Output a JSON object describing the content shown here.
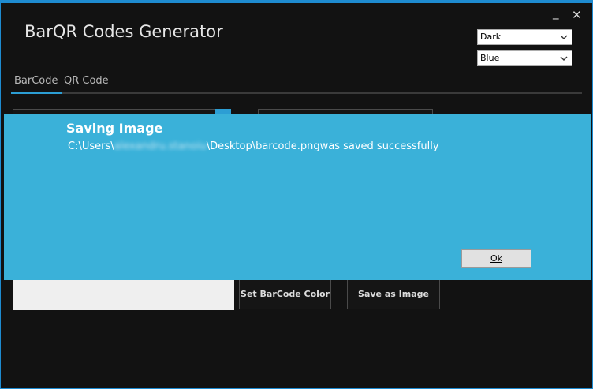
{
  "app": {
    "title": "BarQR Codes Generator"
  },
  "window_controls": {
    "minimize": "_",
    "close": "✕"
  },
  "theme_select": {
    "value": "Dark"
  },
  "accent_select": {
    "value": "Blue"
  },
  "tabs": [
    {
      "label": "BarCode",
      "active": true
    },
    {
      "label": "QR Code",
      "active": false
    }
  ],
  "buttons": {
    "set_color": "Set BarCode Color",
    "save_image": "Save as Image"
  },
  "dialog": {
    "title": "Saving Image",
    "message_prefix": "C:\\Users\\",
    "message_user": "alexandru.stanoiu",
    "message_suffix": "\\Desktop\\barcode.pngwas saved successfully",
    "ok_label": "Ok"
  },
  "colors": {
    "accent": "#2c9ed4",
    "dialog_bg": "#3ab1d9",
    "window_bg": "#121212",
    "border": "#1e8bd0"
  }
}
